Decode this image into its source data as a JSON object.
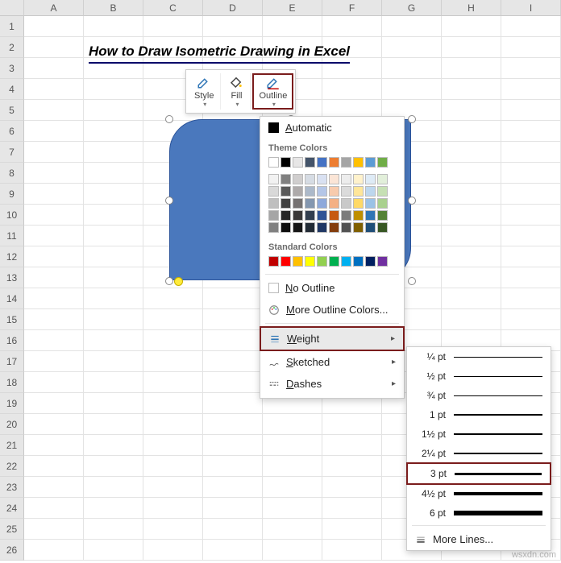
{
  "columns": [
    "A",
    "B",
    "C",
    "D",
    "E",
    "F",
    "G",
    "H",
    "I"
  ],
  "row_count": 26,
  "title": "How to Draw Isometric Drawing in Excel",
  "toolbar": {
    "style": "Style",
    "fill": "Fill",
    "outline": "Outline"
  },
  "dropdown": {
    "automatic": "Automatic",
    "theme_colors_label": "Theme Colors",
    "standard_colors_label": "Standard Colors",
    "no_outline": "No Outline",
    "more_colors": "More Outline Colors...",
    "weight": "Weight",
    "sketched": "Sketched",
    "dashes": "Dashes"
  },
  "theme_palette_row1": [
    "#ffffff",
    "#000000",
    "#e7e6e6",
    "#44546a",
    "#4472c4",
    "#ed7d31",
    "#a5a5a5",
    "#ffc000",
    "#5b9bd5",
    "#70ad47"
  ],
  "theme_shades": [
    [
      "#f2f2f2",
      "#808080",
      "#d0cece",
      "#d6dce4",
      "#d9e1f2",
      "#fbe5d6",
      "#ededed",
      "#fff2cc",
      "#deebf6",
      "#e2efda"
    ],
    [
      "#d9d9d9",
      "#595959",
      "#aeaaaa",
      "#acb9ca",
      "#b4c6e7",
      "#f8cbad",
      "#dbdbdb",
      "#ffe699",
      "#bdd7ee",
      "#c6e0b4"
    ],
    [
      "#bfbfbf",
      "#404040",
      "#757171",
      "#8497b0",
      "#8ea9db",
      "#f4b084",
      "#c9c9c9",
      "#ffd966",
      "#9bc2e6",
      "#a9d08e"
    ],
    [
      "#a6a6a6",
      "#262626",
      "#3a3838",
      "#333f4f",
      "#305496",
      "#c65911",
      "#7b7b7b",
      "#bf8f00",
      "#2f75b5",
      "#548235"
    ],
    [
      "#808080",
      "#0d0d0d",
      "#161616",
      "#222b35",
      "#203764",
      "#833c0c",
      "#525252",
      "#806000",
      "#1f4e78",
      "#375623"
    ]
  ],
  "standard_colors": [
    "#c00000",
    "#ff0000",
    "#ffc000",
    "#ffff00",
    "#92d050",
    "#00b050",
    "#00b0f0",
    "#0070c0",
    "#002060",
    "#7030a0"
  ],
  "weights": [
    {
      "label": "¼ pt",
      "h": 0.5
    },
    {
      "label": "½ pt",
      "h": 1
    },
    {
      "label": "¾ pt",
      "h": 1
    },
    {
      "label": "1 pt",
      "h": 1.5
    },
    {
      "label": "1½ pt",
      "h": 2
    },
    {
      "label": "2¼ pt",
      "h": 2.5
    },
    {
      "label": "3 pt",
      "h": 3
    },
    {
      "label": "4½ pt",
      "h": 4.5
    },
    {
      "label": "6 pt",
      "h": 6
    }
  ],
  "more_lines": "More Lines...",
  "watermark": "wsxdn.com"
}
